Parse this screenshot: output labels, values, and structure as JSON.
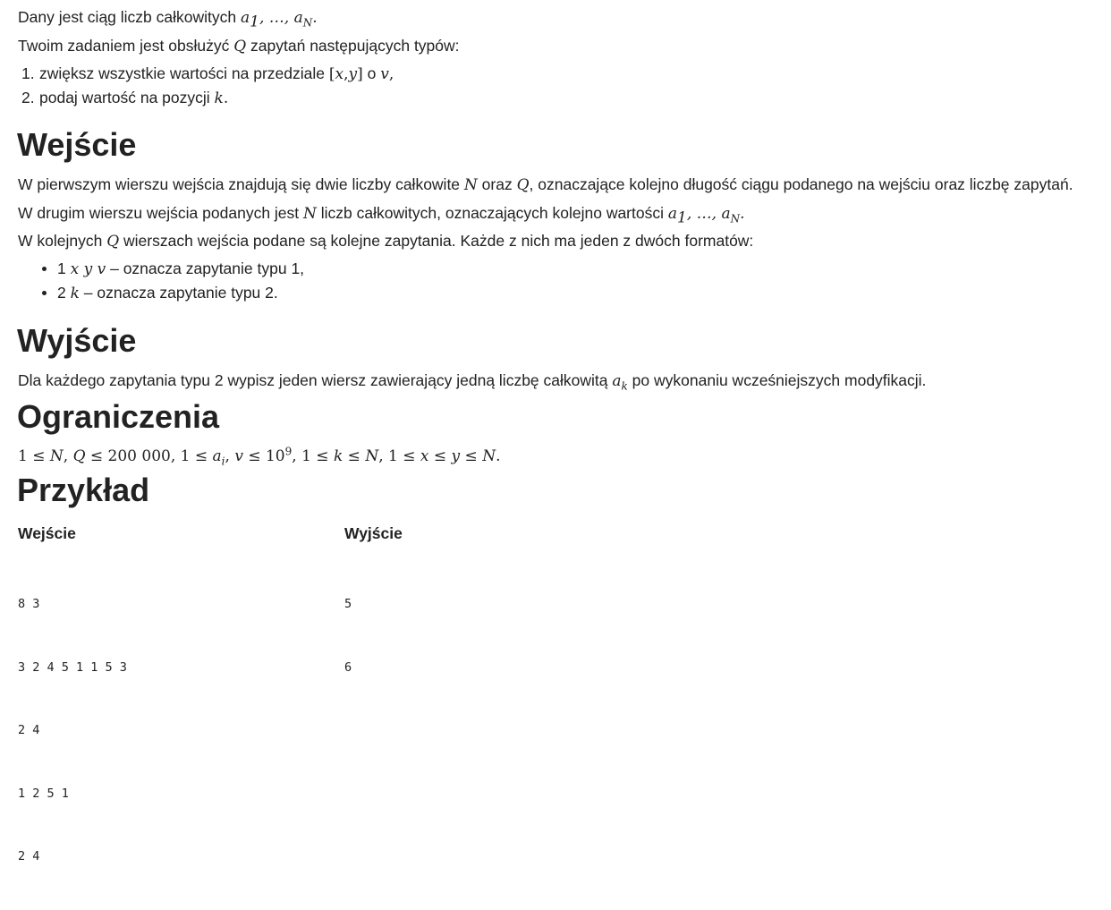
{
  "intro": {
    "line1_pre": "Dany jest ciąg liczb całkowitych",
    "line2_pre": "Twoim zadaniem jest obsłużyć",
    "line2_post": "zapytań następujących typów:",
    "list": [
      {
        "num": "1.",
        "pre": "zwiększ wszystkie wartości na przedziale",
        "post": "o"
      },
      {
        "num": "2.",
        "pre": "podaj wartość na pozycji"
      }
    ]
  },
  "sections": {
    "input_heading": "Wejście",
    "output_heading": "Wyjście",
    "constraints_heading": "Ograniczenia",
    "example_heading": "Przykład"
  },
  "input_section": {
    "p1_a": "W pierwszym wierszu wejścia znajdują się dwie liczby całkowite",
    "p1_b": "oraz",
    "p1_c": ", oznaczające kolejno długość ciągu podanego na wejściu oraz liczbę zapytań.",
    "p2_a": "W drugim wierszu wejścia podanych jest",
    "p2_b": "liczb całkowitych, oznaczających kolejno wartości",
    "p3_a": "W kolejnych",
    "p3_b": "wierszach wejścia podane są kolejne zapytania. Każde z nich ma jeden z dwóch formatów:",
    "bullets": [
      {
        "lead": "1",
        "desc": "– oznacza zapytanie typu 1,"
      },
      {
        "lead": "2",
        "desc": "– oznacza zapytanie typu 2."
      }
    ]
  },
  "output_section": {
    "a": "Dla każdego zapytania typu 2 wypisz jeden wiersz zawierający jedną liczbę całkowitą",
    "b": "po wykonaniu wcześniejszych modyfikacji."
  },
  "example": {
    "input_label": "Wejście",
    "output_label": "Wyjście",
    "input_lines": [
      "8 3",
      "3 2 4 5 1 1 5 3",
      "2 4",
      "1 2 5 1",
      "2 4"
    ],
    "output_lines": [
      "5",
      "6"
    ]
  }
}
